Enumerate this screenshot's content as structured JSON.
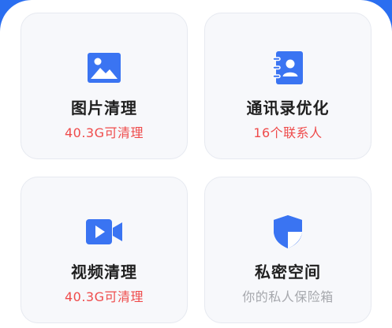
{
  "colors": {
    "accent_blue": "#2a6ef0",
    "icon_blue": "#3a74f2",
    "subtitle_red": "#ef4b4b",
    "subtitle_gray": "#a6a8ad",
    "card_bg": "#f7f8fb"
  },
  "cards": [
    {
      "title": "图片清理",
      "subtitle": "40.3G可清理",
      "icon": "image-icon"
    },
    {
      "title": "通讯录优化",
      "subtitle": "16个联系人",
      "icon": "contacts-icon"
    },
    {
      "title": "视频清理",
      "subtitle": "40.3G可清理",
      "icon": "video-icon"
    },
    {
      "title": "私密空间",
      "subtitle": "你的私人保险箱",
      "icon": "shield-icon"
    }
  ]
}
